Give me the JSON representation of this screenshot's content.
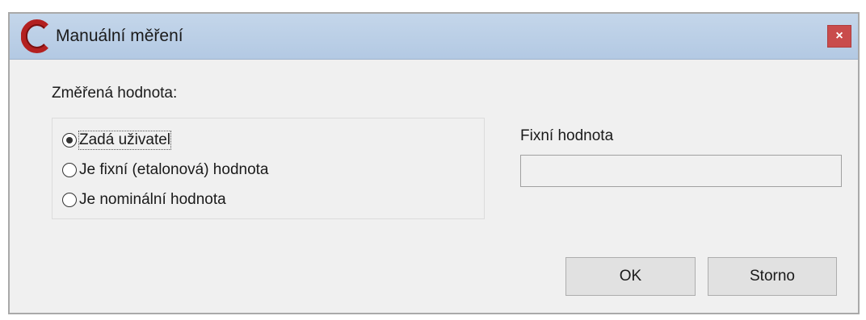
{
  "window": {
    "title": "Manuální měření",
    "close_label": "×",
    "logo_icon": "app-logo-c-icon",
    "brand_color": "#b32020"
  },
  "measured_value": {
    "label": "Změřená hodnota:",
    "options": [
      {
        "label": "Zadá uživatel",
        "checked": true
      },
      {
        "label": "Je fixní (etalonová) hodnota",
        "checked": false
      },
      {
        "label": "Je nominální hodnota",
        "checked": false
      }
    ]
  },
  "fixed_value": {
    "label": "Fixní hodnota",
    "value": "",
    "placeholder": ""
  },
  "buttons": {
    "ok_label": "OK",
    "cancel_label": "Storno"
  }
}
